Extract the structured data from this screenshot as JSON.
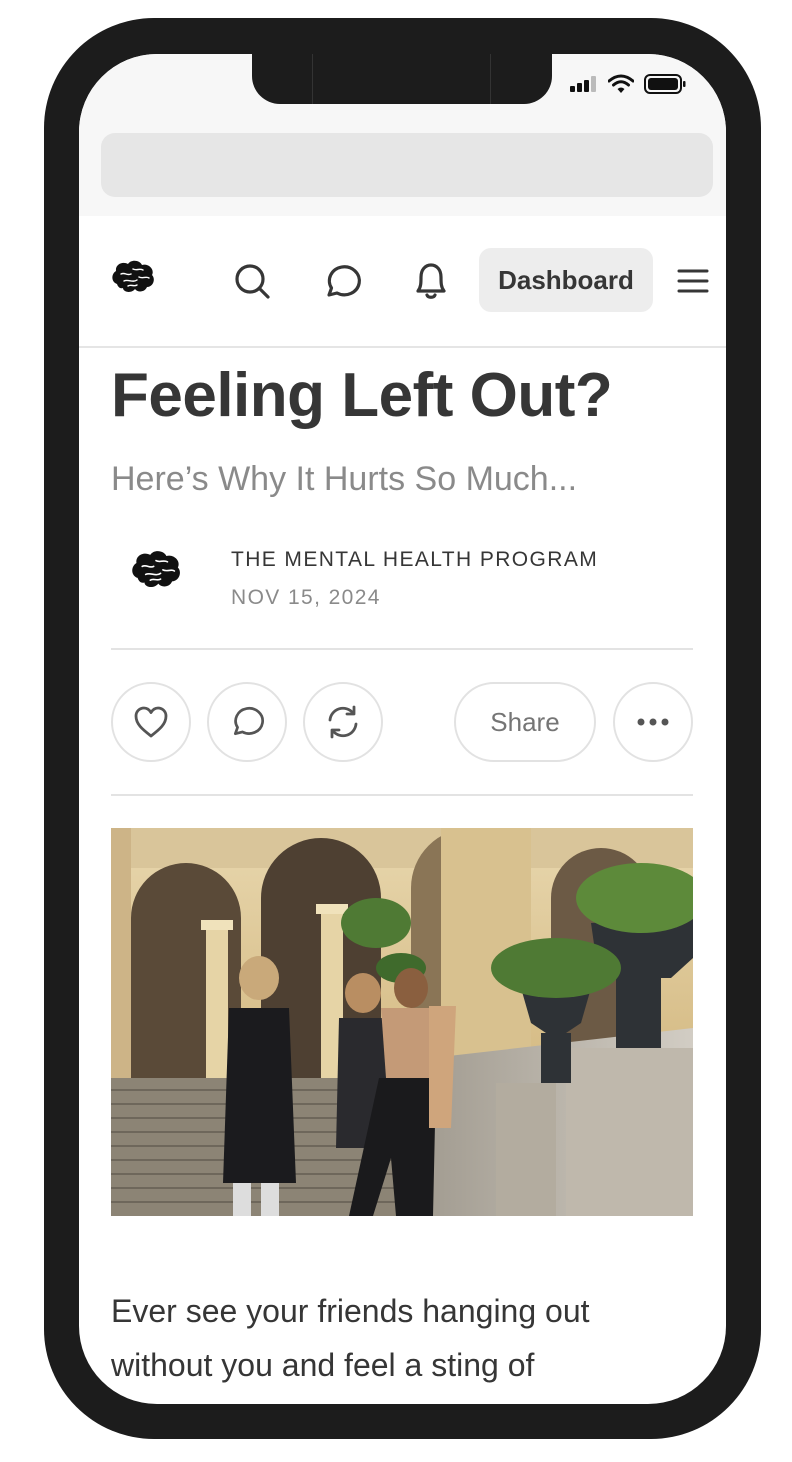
{
  "status_bar": {
    "signal_icon": "cellular-signal-icon",
    "wifi_icon": "wifi-icon",
    "battery_icon": "battery-icon"
  },
  "browser": {
    "url_bar_value": ""
  },
  "nav": {
    "logo_icon": "brain-logo-icon",
    "search_icon": "search-icon",
    "chat_icon": "chat-bubble-icon",
    "notifications_icon": "bell-icon",
    "dashboard_label": "Dashboard",
    "menu_icon": "hamburger-menu-icon"
  },
  "post": {
    "title": "Feeling Left Out?",
    "subtitle": "Here’s Why It Hurts So Much...",
    "author": "THE MENTAL HEALTH PROGRAM",
    "date": "NOV 15, 2024",
    "actions": {
      "like_icon": "heart-icon",
      "comment_icon": "comment-icon",
      "restack_icon": "restack-icon",
      "share_label": "Share",
      "more_icon": "ellipsis-icon"
    },
    "body_text": "Ever see your friends hanging out without you and feel a sting of"
  },
  "colors": {
    "text_primary": "#363636",
    "text_secondary": "#8a8a8a",
    "button_bg": "#ededed",
    "frame": "#1c1c1c"
  }
}
